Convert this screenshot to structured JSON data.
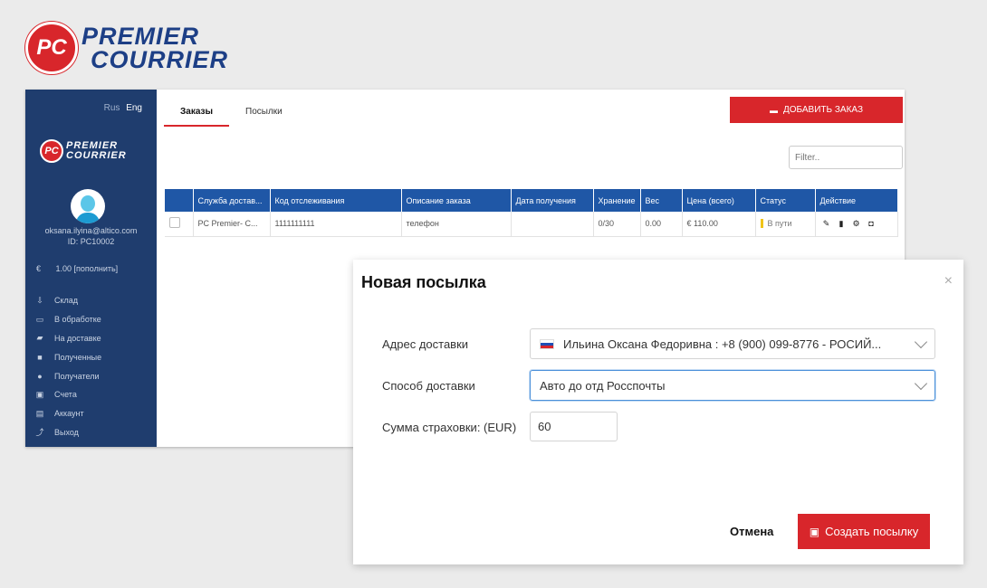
{
  "brand": {
    "logo_mark": "PC",
    "logo_line1": "PREMIER",
    "logo_line2": "COURRIER"
  },
  "sidebar": {
    "lang_rus": "Rus",
    "lang_eng": "Eng",
    "logo_mark": "PC",
    "logo_line1": "PREMIER",
    "logo_line2": "COURRIER",
    "user_email": "oksana.ilyina@altico.com",
    "user_id": "ID: PC10002",
    "balance_symbol": "€",
    "balance_text": "1.00 [пополнить]",
    "nav": [
      {
        "icon": "warehouse-icon",
        "label": "Склад"
      },
      {
        "icon": "inbox-icon",
        "label": "В обработке"
      },
      {
        "icon": "truck-icon",
        "label": "На доставке"
      },
      {
        "icon": "box-icon",
        "label": "Полученные"
      },
      {
        "icon": "users-icon",
        "label": "Получатели"
      },
      {
        "icon": "invoice-icon",
        "label": "Счета"
      },
      {
        "icon": "account-icon",
        "label": "Аккаунт"
      },
      {
        "icon": "exit-icon",
        "label": "Выход"
      }
    ]
  },
  "main": {
    "tabs": [
      "Заказы",
      "Посылки"
    ],
    "add_order_label": "ДОБАВИТЬ ЗАКАЗ",
    "filter_placeholder": "Filter..",
    "table": {
      "headers": [
        "",
        "Служба достав...",
        "Код отслеживания",
        "Описание заказа",
        "Дата получения",
        "Хранение",
        "Вес",
        "Цена (всего)",
        "Статус",
        "Действие"
      ],
      "rows": [
        {
          "service": "PC Premier- C...",
          "tracking": "1111111111",
          "description": "телефон",
          "date": "",
          "storage": "0/30",
          "weight": "0.00",
          "price": "€ 110.00",
          "status": "В пути"
        }
      ]
    }
  },
  "modal": {
    "title": "Новая посылка",
    "close": "×",
    "address_label": "Адрес доставки",
    "address_value": "Ильина Оксана Федоривна : +8 (900) 099-8776 - РОСИЙ...",
    "method_label": "Способ доставки",
    "method_value": "Авто до отд Росспочты",
    "insurance_label": "Сумма страховки: (EUR)",
    "insurance_value": "60",
    "cancel_label": "Отмена",
    "create_label": "Создать посылку"
  },
  "colors": {
    "accent": "#d8262b",
    "sidebar_bg": "#1f3d6e",
    "table_header": "#1f57a6"
  }
}
